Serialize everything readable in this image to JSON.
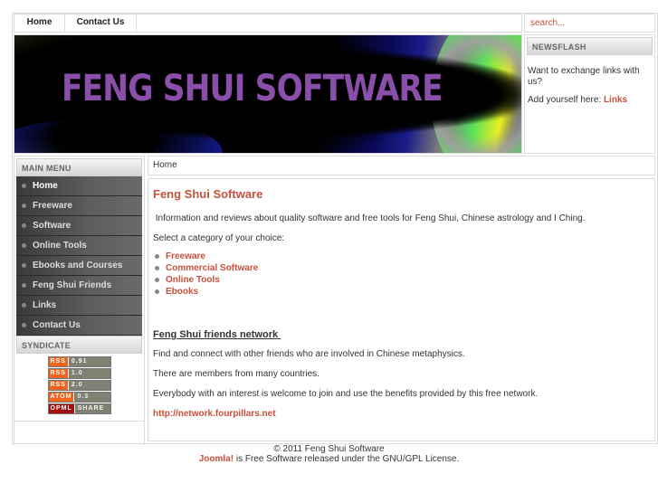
{
  "topnav": {
    "items": [
      {
        "label": "Home"
      },
      {
        "label": "Contact Us"
      }
    ]
  },
  "search": {
    "placeholder": "search..."
  },
  "banner": {
    "title": "FENG SHUI SOFTWARE"
  },
  "newsflash": {
    "heading": "NEWSFLASH",
    "text1": "Want to exchange links with us?",
    "text2_prefix": "Add yourself here:",
    "text2_link": "Links"
  },
  "main_menu": {
    "heading": "MAIN MENU",
    "items": [
      {
        "label": "Home",
        "active": true
      },
      {
        "label": "Freeware"
      },
      {
        "label": "Software"
      },
      {
        "label": "Online Tools"
      },
      {
        "label": "Ebooks and Courses"
      },
      {
        "label": "Feng Shui Friends"
      },
      {
        "label": "Links"
      },
      {
        "label": "Contact Us"
      }
    ]
  },
  "syndicate": {
    "heading": "SYNDICATE",
    "feeds": [
      {
        "type": "RSS",
        "version": "0.91"
      },
      {
        "type": "RSS",
        "version": "1.0"
      },
      {
        "type": "RSS",
        "version": "2.0"
      },
      {
        "type": "ATOM",
        "version": "0.3"
      },
      {
        "type": "OPML",
        "version": "SHARE IT!"
      }
    ]
  },
  "breadcrumb": {
    "label": "Home"
  },
  "content": {
    "title": "Feng Shui Software",
    "intro": "Information and reviews about quality software and free tools for Feng Shui, Chinese astrology and I Ching.",
    "select_prompt": "Select a category of your choice:",
    "categories": [
      {
        "label": "Freeware"
      },
      {
        "label": "Commercial Software"
      },
      {
        "label": "Online Tools"
      },
      {
        "label": "Ebooks"
      }
    ],
    "network_heading": "Feng Shui friends network",
    "network_p1": "Find and connect with other friends who are involved in Chinese metaphysics.",
    "network_p2": "There are members from many countries.",
    "network_p3": "Everybody with an interest is welcome to join and use the benefits provided by this free network.",
    "network_link": "http://network.fourpillars.net"
  },
  "footer": {
    "copyright": "© 2011 Feng Shui Software",
    "joomla_link": "Joomla!",
    "license_text": "is Free Software released under the GNU/GPL License."
  },
  "colors": {
    "accent": "#c8503a",
    "banner_title": "#8a4fab",
    "menu_bg": "#4a4a4a",
    "rss_orange": "#f0641e",
    "opml_red": "#a30f0f"
  }
}
